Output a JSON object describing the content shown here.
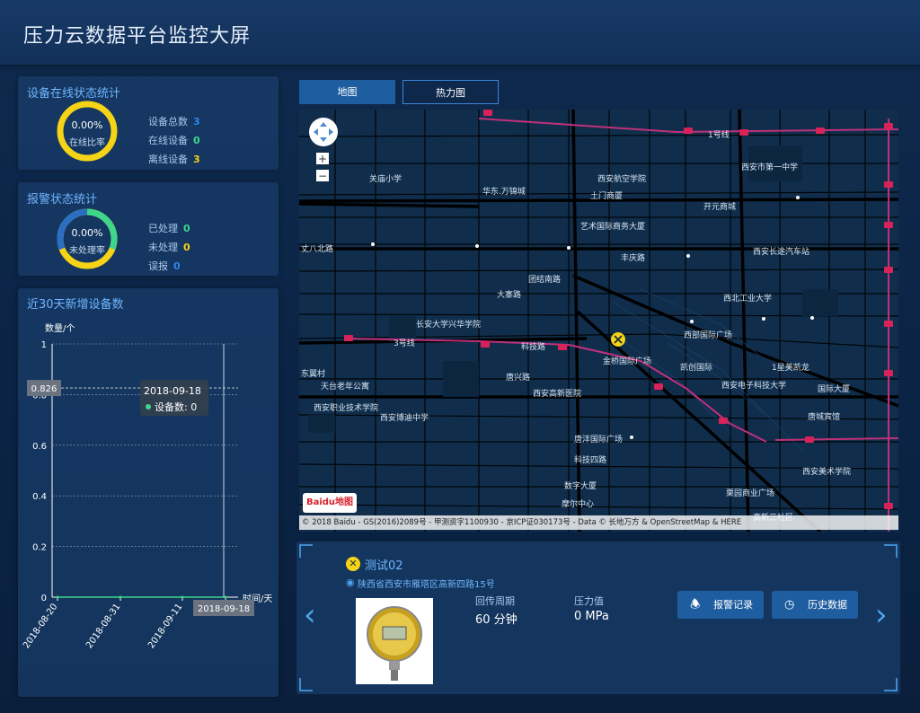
{
  "header": {
    "title": "压力云数据平台监控大屏"
  },
  "online_panel": {
    "title": "设备在线状态统计",
    "ring_percent": "0.00%",
    "ring_label": "在线比率",
    "stats": [
      {
        "label": "设备总数",
        "value": "3",
        "color": "#2f86e8"
      },
      {
        "label": "在线设备",
        "value": "0",
        "color": "#3ed68b"
      },
      {
        "label": "离线设备",
        "value": "3",
        "color": "#f5d316"
      }
    ]
  },
  "alarm_panel": {
    "title": "报警状态统计",
    "ring_percent": "0.00%",
    "ring_label": "未处理率",
    "stats": [
      {
        "label": "已处理",
        "value": "0",
        "color": "#3ed68b"
      },
      {
        "label": "未处理",
        "value": "0",
        "color": "#f5d316"
      },
      {
        "label": "误报",
        "value": "0",
        "color": "#2f86e8"
      }
    ]
  },
  "new_devices_panel": {
    "title": "近30天新增设备数"
  },
  "chart_data": {
    "type": "line",
    "ylabel": "数量/个",
    "xlabel": "时间/天",
    "ylim": [
      0,
      1
    ],
    "y_ticks": [
      "0",
      "0.2",
      "0.4",
      "0.6",
      "0.8",
      "1"
    ],
    "categories": [
      "2018-08-20",
      "2018-08-31",
      "2018-09-11",
      "2018-09-18"
    ],
    "series": [
      {
        "name": "设备数",
        "values": [
          0,
          0,
          0,
          0
        ]
      }
    ],
    "tooltip": {
      "date": "2018-09-18",
      "series": "设备数",
      "value": "0"
    },
    "crosshair_y_label": "0.826",
    "crosshair_x_label": "2018-09-18"
  },
  "map_tabs": [
    {
      "label": "地图",
      "active": true
    },
    {
      "label": "热力图",
      "active": false
    }
  ],
  "map": {
    "labels": [
      "西安市第一中学",
      "西安航空学院",
      "土门商厦",
      "华东.万锦城",
      "关庙小学",
      "开元商城",
      "西安长途汽车站",
      "艺术国际商务大厦",
      "丰庆路",
      "团结南路",
      "大寨路",
      "长安大学兴华学院",
      "3号线",
      "科技路",
      "西北工业大学",
      "西部国际广场",
      "金桥国际广场",
      "凯创国际",
      "唐兴路",
      "西安高新医院",
      "西安电子科技大学",
      "唐城宾馆",
      "西安博迪中学",
      "西安职业技术学院",
      "天台老年公寓",
      "唐沣国际广场",
      "科技四路",
      "数字大厦",
      "摩尔中心",
      "西安美术学院",
      "栗园商业广场",
      "1号线",
      "东翼村",
      "国际大厦",
      "1星美凯龙",
      "高新三社区",
      "丈八北路"
    ],
    "copyright": "© 2018 Baidu - GS(2016)2089号 - 甲测资字1100930 - 京ICP证030173号 - Data © 长地万方 & OpenStreetMap & HERE",
    "logo": "Baidu地图"
  },
  "device": {
    "name": "测试02",
    "address": "陕西省西安市雁塔区高新四路15号",
    "period_label": "回传周期",
    "period_value": "60 分钟",
    "pressure_label": "压力值",
    "pressure_value": "0 MPa",
    "alarm_button": "报警记录",
    "history_button": "历史数据"
  }
}
